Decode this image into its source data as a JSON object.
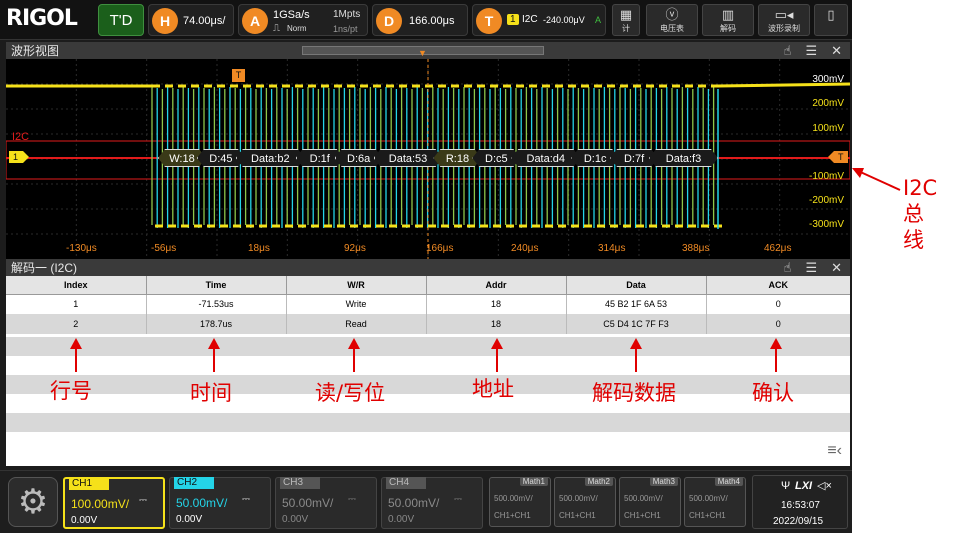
{
  "topbar": {
    "logo": "RIGOL",
    "trigger_status": "T'D",
    "horizontal": {
      "letter": "H",
      "timebase": "74.00μs/"
    },
    "acquire": {
      "letter": "A",
      "sample_rate": "1GSa/s",
      "mode": "Norm",
      "depth": "1Mpts",
      "interval": "1ns/pt"
    },
    "delay": {
      "letter": "D",
      "value": "166.00μs"
    },
    "trigger": {
      "letter": "T",
      "source_badge": "1",
      "type": "I2C",
      "level": "-240.00μV",
      "suffix": "A"
    },
    "buttons": [
      {
        "label": "计",
        "icon": "measure-icon"
      },
      {
        "label": "电压表",
        "icon": "voltmeter-icon"
      },
      {
        "label": "解码",
        "icon": "decode-icon"
      },
      {
        "label": "波形录制",
        "icon": "record-icon"
      },
      {
        "label": "",
        "icon": "more-icon"
      }
    ]
  },
  "waveform_view": {
    "title": "波形视图",
    "bus_label": "I2C",
    "channel_marker": "1",
    "trigger_marker": "T",
    "right_scale": [
      "300mV",
      "200mV",
      "100mV",
      "-100mV",
      "-200mV",
      "-300mV"
    ],
    "time_axis": [
      "-130μs",
      "-56μs",
      "18μs",
      "92μs",
      "166μs",
      "240μs",
      "314μs",
      "388μs",
      "462μs"
    ],
    "decode_frames": [
      "W:18",
      "D:45",
      "Data:b2",
      "D:1f",
      "D:6a",
      "Data:53",
      "R:18",
      "D:c5",
      "Data:d4",
      "D:1c",
      "D:7f",
      "Data:f3"
    ]
  },
  "decode_panel": {
    "title": "解码一 (I2C)",
    "columns": [
      "Index",
      "Time",
      "W/R",
      "Addr",
      "Data",
      "ACK"
    ],
    "rows": [
      [
        "1",
        "-71.53us",
        "Write",
        "18",
        "45 B2 1F 6A 53",
        "0"
      ],
      [
        "2",
        "178.7us",
        "Read",
        "18",
        "C5 D4 1C 7F F3",
        "0"
      ]
    ]
  },
  "annotations": {
    "i2c_bus": "I2C总线",
    "row_number": "行号",
    "time": "时间",
    "read_write": "读/写位",
    "address": "地址",
    "decoded_data": "解码数据",
    "ack": "确认"
  },
  "channels": [
    {
      "name": "CH1",
      "scale": "100.00mV/",
      "offset": "0.00V",
      "color": "#f5e11a",
      "active": true
    },
    {
      "name": "CH2",
      "scale": "50.00mV/",
      "offset": "0.00V",
      "color": "#24d4e8",
      "active": true
    },
    {
      "name": "CH3",
      "scale": "50.00mV/",
      "offset": "0.00V",
      "color": "#8a8a8a",
      "active": false
    },
    {
      "name": "CH4",
      "scale": "50.00mV/",
      "offset": "0.00V",
      "color": "#8a8a8a",
      "active": false
    }
  ],
  "math": [
    {
      "name": "Math1",
      "scale": "500.00mV/",
      "expr": "CH1+CH1"
    },
    {
      "name": "Math2",
      "scale": "500.00mV/",
      "expr": "CH1+CH1"
    },
    {
      "name": "Math3",
      "scale": "500.00mV/",
      "expr": "CH1+CH1"
    },
    {
      "name": "Math4",
      "scale": "500.00mV/",
      "expr": "CH1+CH1"
    }
  ],
  "status": {
    "time": "16:53:07",
    "date": "2022/09/15",
    "lxi": "LXI"
  },
  "colors": {
    "ch1": "#f5e11a",
    "ch2": "#24d4e8",
    "bus": "#e21b1b",
    "trigger": "#f08a24",
    "annotation": "#e00000"
  }
}
